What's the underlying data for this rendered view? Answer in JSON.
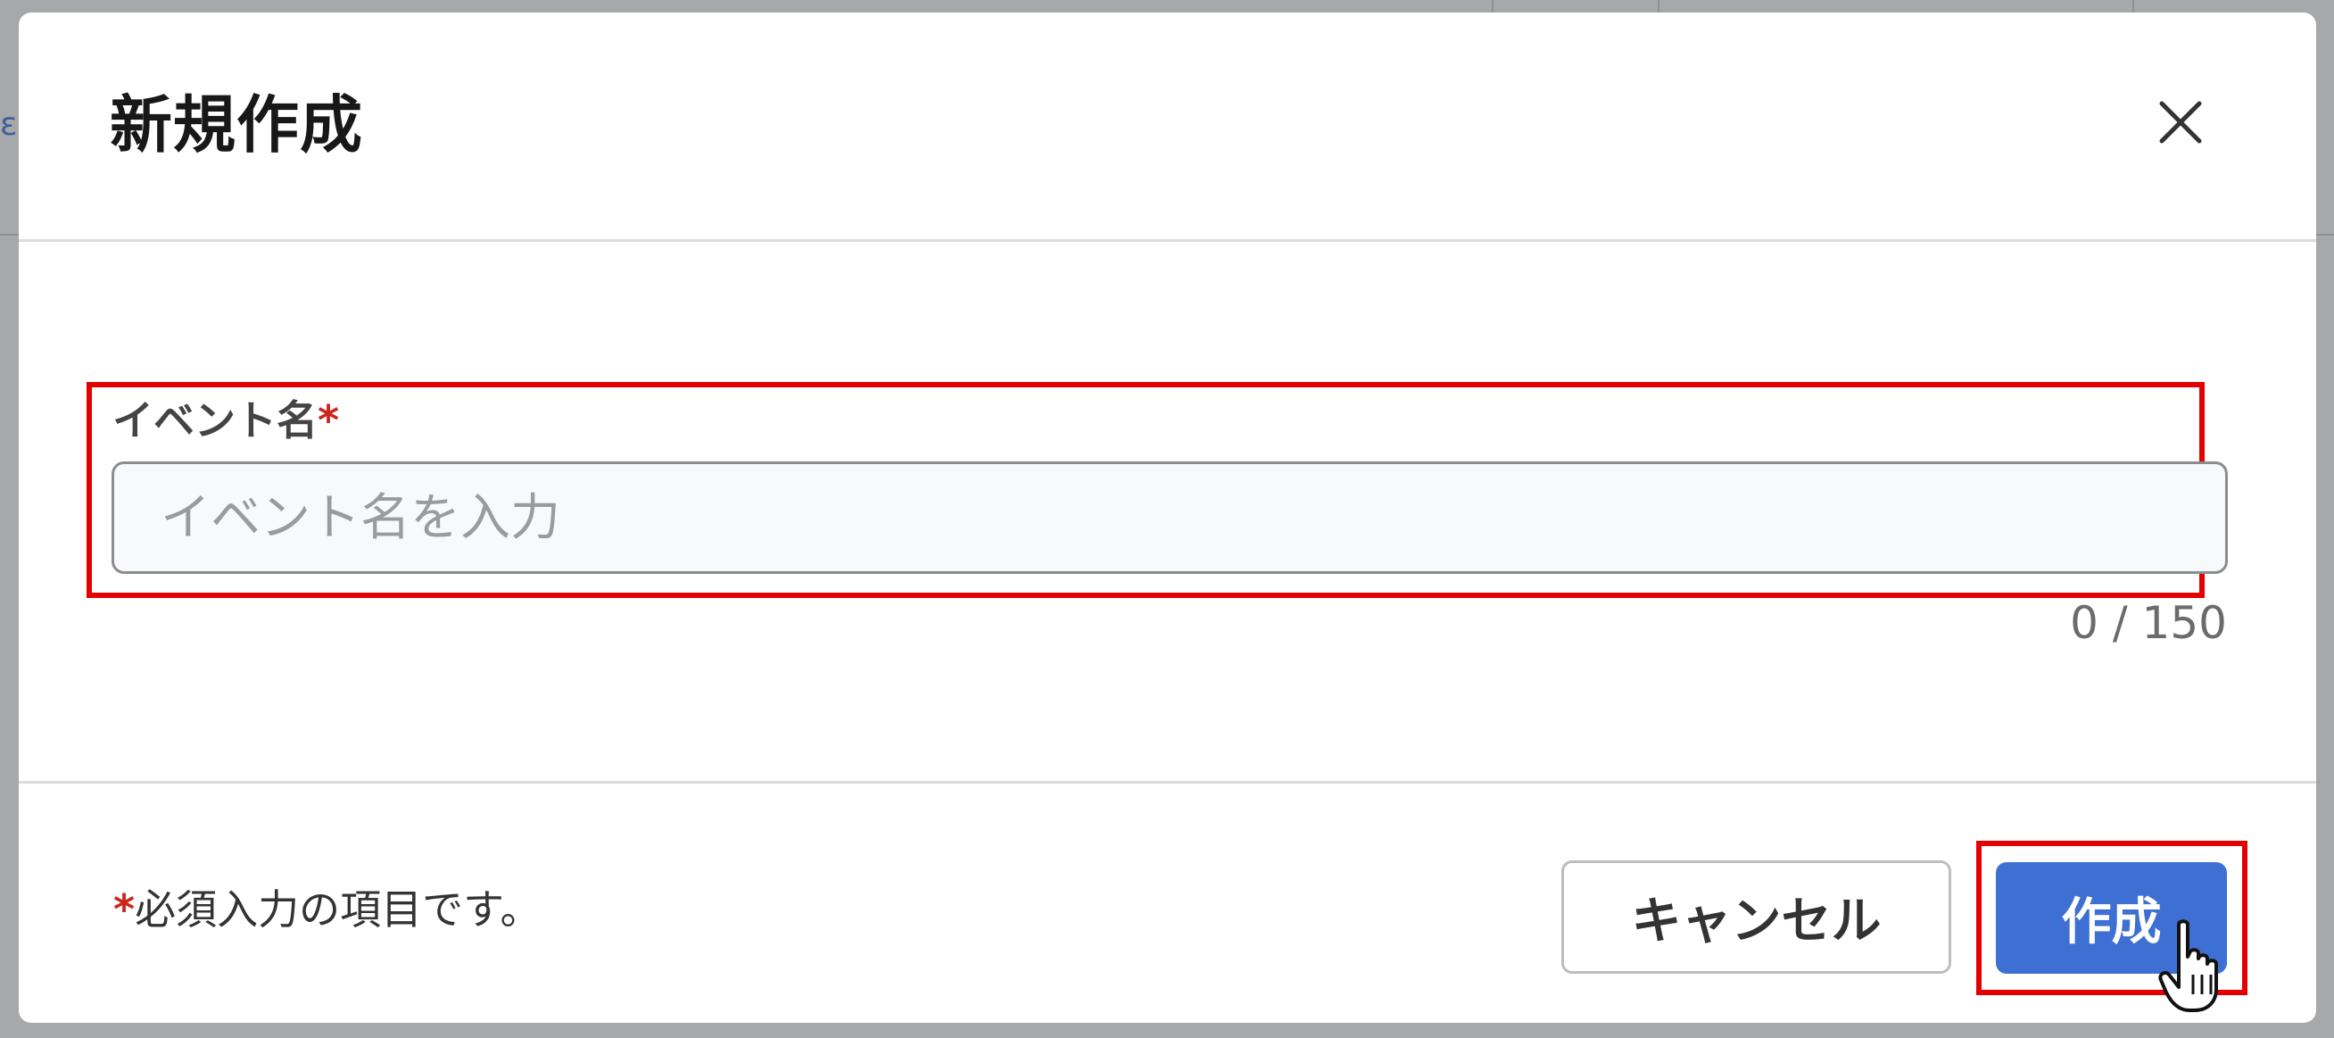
{
  "dialog": {
    "title": "新規作成",
    "close_icon": "close-icon"
  },
  "form": {
    "event_name": {
      "label": "イベント名",
      "required_mark": "*",
      "placeholder": "イベント名を入力",
      "value": "",
      "counter": "0 / 150"
    }
  },
  "footer": {
    "required_mark": "*",
    "required_note": "必須入力の項目です。",
    "cancel_label": "キャンセル",
    "create_label": "作成"
  },
  "background": {
    "link_fragment": "ε"
  },
  "colors": {
    "primary": "#3e6fd2",
    "required": "#c9261c",
    "highlight": "#e30000",
    "overlay": "#a6a8aa"
  },
  "icons": {
    "cursor": "hand-pointer-icon"
  }
}
